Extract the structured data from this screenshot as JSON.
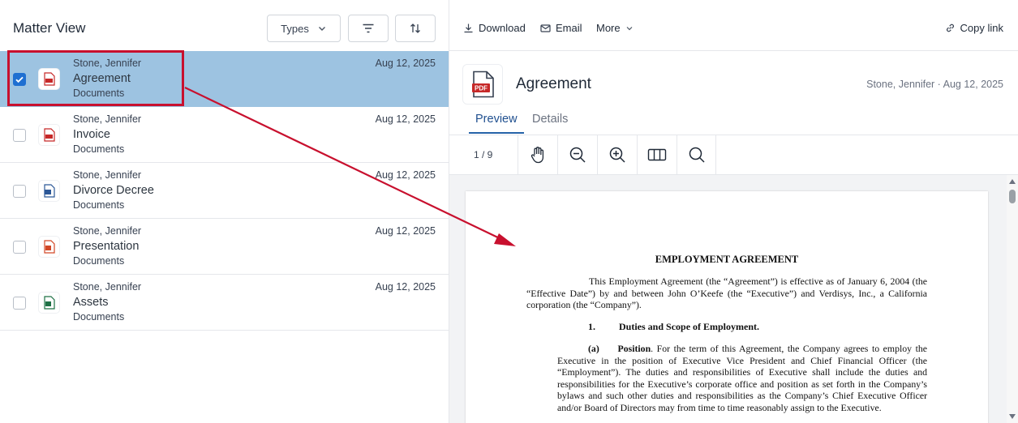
{
  "left_panel": {
    "title": "Matter View",
    "types_label": "Types",
    "filter_icon": "filter-icon",
    "sort_icon": "sort-icon"
  },
  "documents": [
    {
      "owner": "Stone, Jennifer",
      "name": "Agreement",
      "category": "Documents",
      "date": "Aug 12, 2025",
      "type": "pdf",
      "selected": true
    },
    {
      "owner": "Stone, Jennifer",
      "name": "Invoice",
      "category": "Documents",
      "date": "Aug 12, 2025",
      "type": "pdf",
      "selected": false
    },
    {
      "owner": "Stone, Jennifer",
      "name": "Divorce Decree",
      "category": "Documents",
      "date": "Aug 12, 2025",
      "type": "word",
      "selected": false
    },
    {
      "owner": "Stone, Jennifer",
      "name": "Presentation",
      "category": "Documents",
      "date": "Aug 12, 2025",
      "type": "powerpoint",
      "selected": false
    },
    {
      "owner": "Stone, Jennifer",
      "name": "Assets",
      "category": "Documents",
      "date": "Aug 12, 2025",
      "type": "excel",
      "selected": false
    }
  ],
  "toolbar": {
    "download": "Download",
    "email": "Email",
    "more": "More",
    "copy_link": "Copy link"
  },
  "preview": {
    "title": "Agreement",
    "meta": "Stone, Jennifer · Aug 12, 2025",
    "tabs": [
      "Preview",
      "Details"
    ],
    "active_tab": "Preview",
    "page_indicator": "1 / 9",
    "file_badge": "PDF"
  },
  "viewer_tools": [
    "pan-icon",
    "zoom-out-icon",
    "zoom-in-icon",
    "page-layout-icon",
    "search-icon"
  ],
  "document_page": {
    "heading": "EMPLOYMENT AGREEMENT",
    "para1": "This Employment Agreement (the “Agreement”) is effective as of January 6, 2004 (the “Effective Date”) by and between John O’Keefe (the “Executive”) and Verdisys, Inc., a California corporation (the “Company”).",
    "section_number": "1.",
    "section_title": "Duties and Scope of Employment.",
    "sub_label": "(a)",
    "sub_title": "Position",
    "para2": ". For the term of this Agreement, the Company agrees to employ the Executive in the position of Executive Vice President and Chief Financial Officer (the “Employment”). The duties and responsibilities of Executive shall include the duties and responsibilities for the Executive’s corporate office and position as set forth in the Company’s bylaws and such other duties and responsibilities as the Company’s Chief Executive Officer and/or Board of Directors may from time to time reasonably assign to the Executive."
  },
  "colors": {
    "selected_row": "#9dc3e1",
    "annotation": "#c8102e",
    "checkbox_checked": "#1f6fd1",
    "pdf_red": "#c62828",
    "word_blue": "#2b5797",
    "ppt_orange": "#d24726",
    "excel_green": "#1e7145"
  }
}
